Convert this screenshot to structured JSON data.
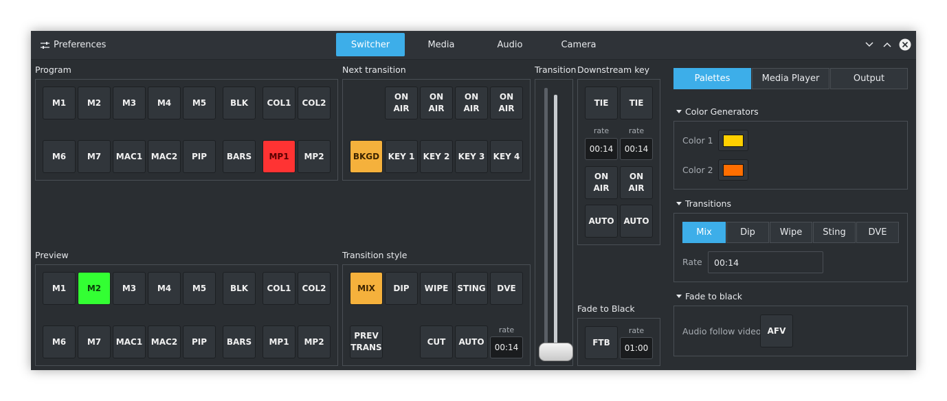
{
  "titlebar": {
    "preferences_label": "Preferences",
    "tabs": [
      "Switcher",
      "Media",
      "Audio",
      "Camera"
    ]
  },
  "program": {
    "title": "Program",
    "row1": [
      "M1",
      "M2",
      "M3",
      "M4",
      "M5",
      "BLK",
      "COL1",
      "COL2"
    ],
    "row2": [
      "M6",
      "M7",
      "MAC1",
      "MAC2",
      "PIP",
      "BARS",
      "MP1",
      "MP2"
    ]
  },
  "preview": {
    "title": "Preview",
    "row1": [
      "M1",
      "M2",
      "M3",
      "M4",
      "M5",
      "BLK",
      "COL1",
      "COL2"
    ],
    "row2": [
      "M6",
      "M7",
      "MAC1",
      "MAC2",
      "PIP",
      "BARS",
      "MP1",
      "MP2"
    ]
  },
  "next_transition": {
    "title": "Next transition",
    "onair": [
      "ON\nAIR",
      "ON\nAIR",
      "ON\nAIR",
      "ON\nAIR"
    ],
    "keys": [
      "BKGD",
      "KEY 1",
      "KEY 2",
      "KEY 3",
      "KEY 4"
    ]
  },
  "transition_style": {
    "title": "Transition style",
    "styles": [
      "MIX",
      "DIP",
      "WIPE",
      "STING",
      "DVE"
    ],
    "prev_trans": "PREV\nTRANS",
    "cut": "CUT",
    "auto": "AUTO",
    "rate_label": "rate",
    "rate_value": "00:14"
  },
  "transition_bar": {
    "title": "Transition",
    "position": 1.0
  },
  "downstream_key": {
    "title": "Downstream key",
    "tie": [
      "TIE",
      "TIE"
    ],
    "rate_label": "rate",
    "rates": [
      "00:14",
      "00:14"
    ],
    "onair": [
      "ON\nAIR",
      "ON\nAIR"
    ],
    "auto": [
      "AUTO",
      "AUTO"
    ]
  },
  "fade_to_black": {
    "title": "Fade to Black",
    "ftb": "FTB",
    "rate_label": "rate",
    "rate_value": "01:00"
  },
  "right_tabs": [
    "Palettes",
    "Media Player",
    "Output"
  ],
  "color_generators": {
    "title": "Color Generators",
    "items": [
      {
        "label": "Color 1",
        "color": "#ffd000"
      },
      {
        "label": "Color 2",
        "color": "#ff6e00"
      }
    ]
  },
  "transitions_panel": {
    "title": "Transitions",
    "types": [
      "Mix",
      "Dip",
      "Wipe",
      "Sting",
      "DVE"
    ],
    "rate_label": "Rate",
    "rate_value": "00:14"
  },
  "fade_panel": {
    "title": "Fade to black",
    "afv_label": "Audio follow video",
    "afv_button": "AFV"
  },
  "colors": {
    "accent": "#3daee9",
    "program_active": "#ff3333",
    "preview_active": "#33ff33",
    "selected": "#f5b13c"
  }
}
